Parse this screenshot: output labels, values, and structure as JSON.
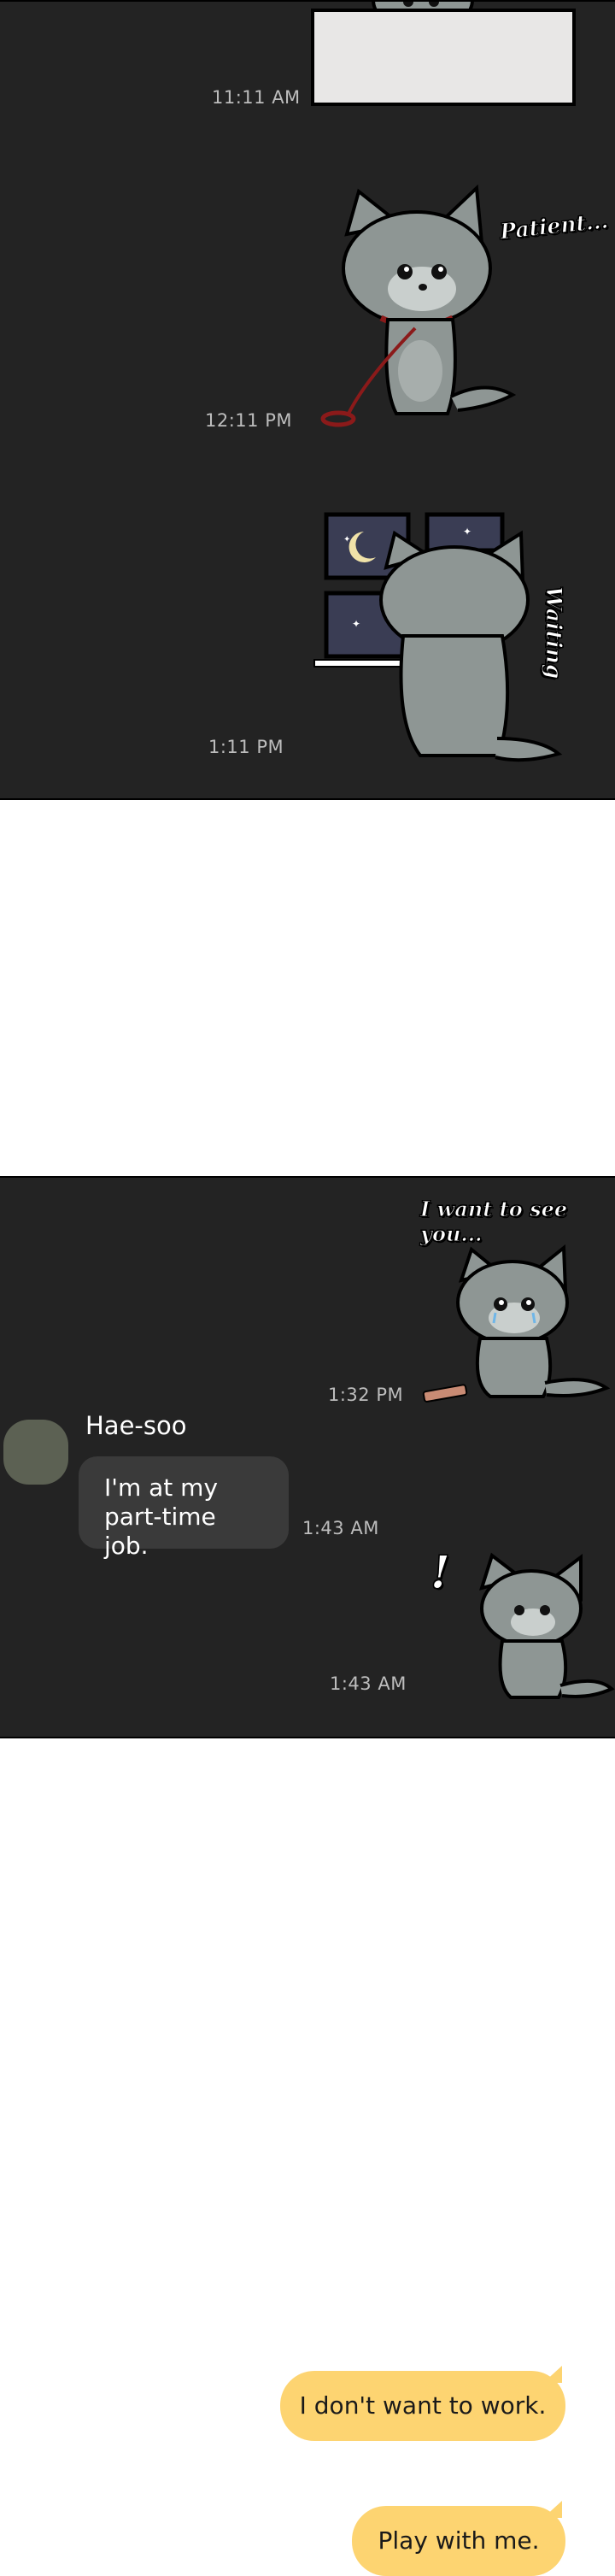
{
  "panel1": {
    "messages": [
      {
        "time": "11:11 AM"
      },
      {
        "time": "12:11 PM",
        "caption": "Patient..."
      },
      {
        "time": "1:11 PM",
        "caption": "Waiting"
      }
    ]
  },
  "panel2": {
    "top_caption": "I want to see you...",
    "sticker_time": "1:32 PM",
    "sender_name": "Hae-soo",
    "incoming_message": "I'm at my part-time job.",
    "incoming_time": "1:43 AM",
    "reply_sticker_mark": "!",
    "reply_time": "1:43 AM"
  },
  "outgoing": [
    {
      "text": "I don't want to work."
    },
    {
      "text": "Play with me."
    }
  ],
  "colors": {
    "panel_bg": "#232323",
    "outgoing_bubble": "#fdd471",
    "incoming_bubble": "#3a3a3a",
    "avatar": "#5c6153",
    "cat_fur": "#8e9694"
  }
}
